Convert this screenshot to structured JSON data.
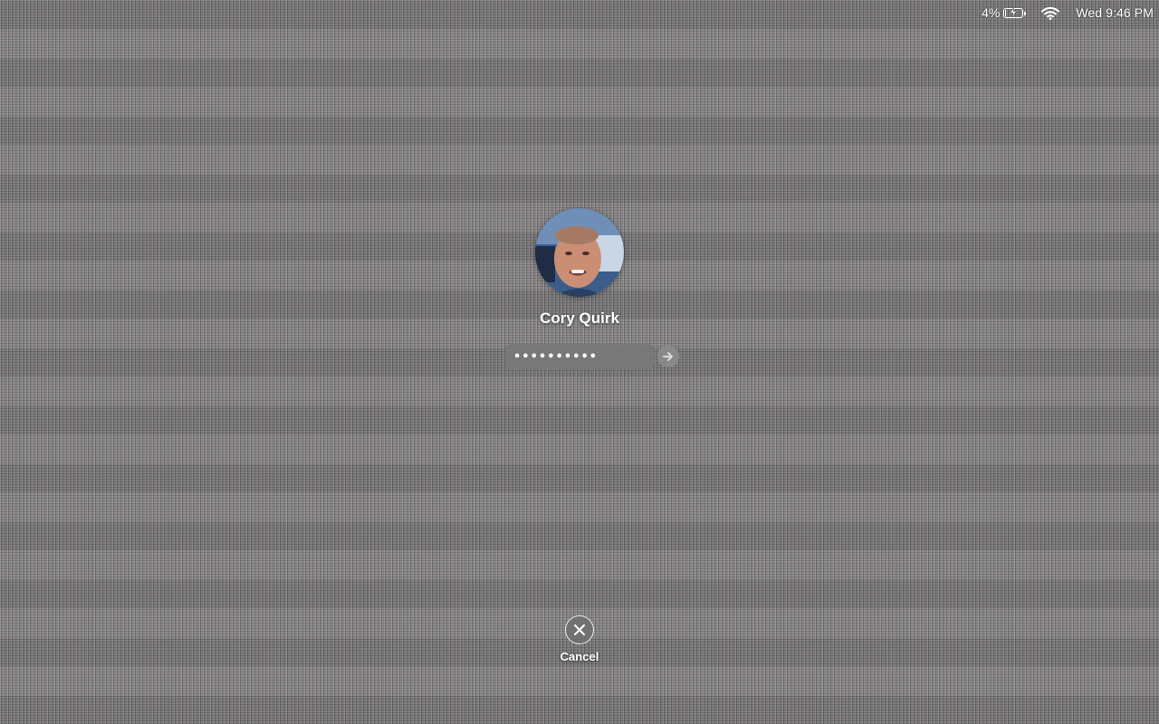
{
  "status_bar": {
    "battery_percent": "4%",
    "battery_level": 0.04,
    "battery_charging": true,
    "battery_icon": "battery-charging-icon",
    "wifi_icon": "wifi-icon",
    "clock": "Wed 9:46 PM"
  },
  "login": {
    "avatar_icon": "user-avatar",
    "user_name": "Cory Quirk",
    "password_masked": "••••••••••",
    "submit_icon": "arrow-right-icon"
  },
  "cancel": {
    "icon": "close-circle-icon",
    "label": "Cancel"
  }
}
